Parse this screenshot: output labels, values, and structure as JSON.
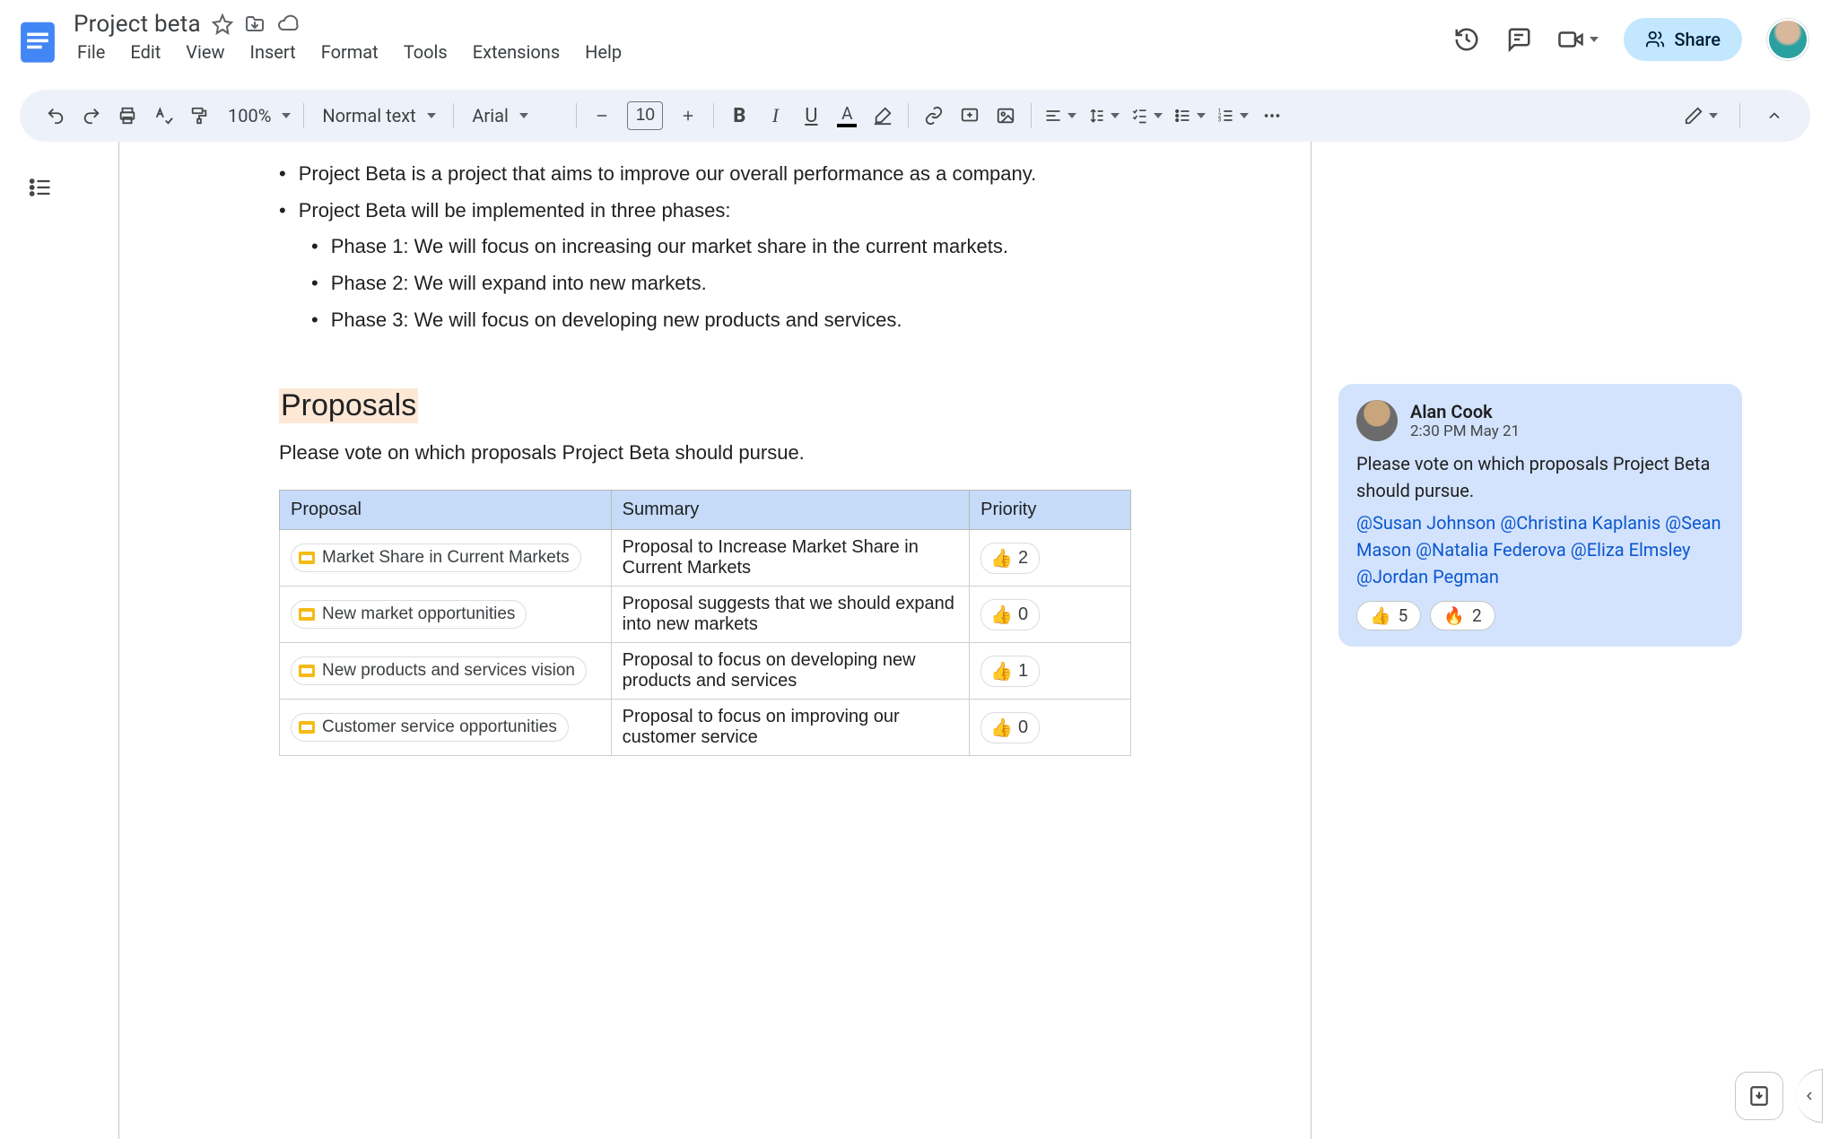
{
  "doc": {
    "title": "Project beta"
  },
  "menus": {
    "file": "File",
    "edit": "Edit",
    "view": "View",
    "insert": "Insert",
    "format": "Format",
    "tools": "Tools",
    "extensions": "Extensions",
    "help": "Help"
  },
  "toolbar": {
    "zoom": "100%",
    "style": "Normal text",
    "font": "Arial",
    "font_size": "10",
    "share": "Share"
  },
  "content": {
    "bullets": [
      "Project Beta is a project that aims to improve our overall performance as a company.",
      "Project Beta will be implemented in three phases:"
    ],
    "phases": [
      "Phase 1: We will focus on increasing our market share in the current markets.",
      "Phase 2: We will expand into new markets.",
      "Phase 3: We will focus on developing new products and services."
    ],
    "heading": "Proposals",
    "subtext": "Please vote on which proposals Project Beta should pursue.",
    "table": {
      "headers": {
        "proposal": "Proposal",
        "summary": "Summary",
        "priority": "Priority"
      },
      "rows": [
        {
          "title": "Market Share in Current Markets",
          "summary": "Proposal to Increase Market Share in Current Markets",
          "votes": "2"
        },
        {
          "title": "New market opportunities",
          "summary": "Proposal suggests that we should expand into new markets",
          "votes": "0"
        },
        {
          "title": "New products and services vision",
          "summary": "Proposal to focus on developing new products and services",
          "votes": "1"
        },
        {
          "title": "Customer service opportunities",
          "summary": "Proposal to focus on improving our customer service",
          "votes": "0"
        }
      ]
    }
  },
  "comment": {
    "author": "Alan Cook",
    "time": "2:30 PM May 21",
    "text": "Please vote on which proposals Project Beta should pursue.",
    "mentions": [
      "@Susan Johnson",
      "@Christina Kaplanis",
      "@Sean Mason",
      "@Natalia Federova",
      "@Eliza Elmsley",
      "@Jordan Pegman"
    ],
    "reactions": [
      {
        "emoji": "👍",
        "count": "5"
      },
      {
        "emoji": "🔥",
        "count": "2"
      }
    ]
  },
  "emoji": {
    "thumbs": "👍"
  }
}
